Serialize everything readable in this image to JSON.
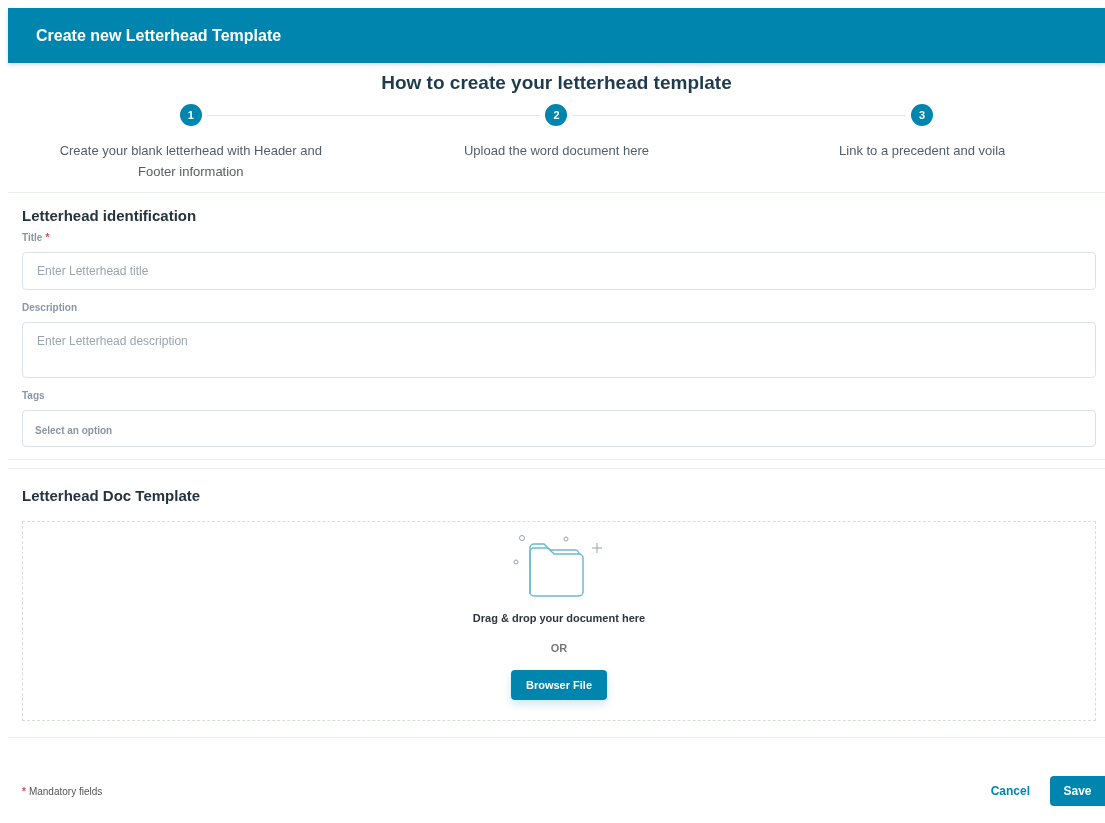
{
  "header": {
    "title": "Create new Letterhead Template"
  },
  "guide": {
    "title": "How to create your letterhead template",
    "steps": [
      {
        "number": "1",
        "text": "Create your blank letterhead with Header and Footer information"
      },
      {
        "number": "2",
        "text": "Upload the word document here"
      },
      {
        "number": "3",
        "text": "Link to a precedent and voila"
      }
    ]
  },
  "identification": {
    "title": "Letterhead identification",
    "fields": [
      {
        "kind": "input",
        "label": "Title",
        "required_mark": "*",
        "placeholder": "Enter Letterhead title"
      },
      {
        "kind": "textarea",
        "label": "Description",
        "placeholder": "Enter Letterhead description"
      },
      {
        "kind": "select",
        "label": "Tags",
        "placeholder": "Select an option"
      }
    ]
  },
  "doc_template": {
    "title": "Letterhead Doc Template",
    "drop_text": "Drag & drop your document here",
    "or_text": "OR",
    "browse_button": "Browser File"
  },
  "footer": {
    "mandatory_mark": "*",
    "mandatory_text": "Mandatory fields",
    "cancel": "Cancel",
    "save": "Save"
  }
}
